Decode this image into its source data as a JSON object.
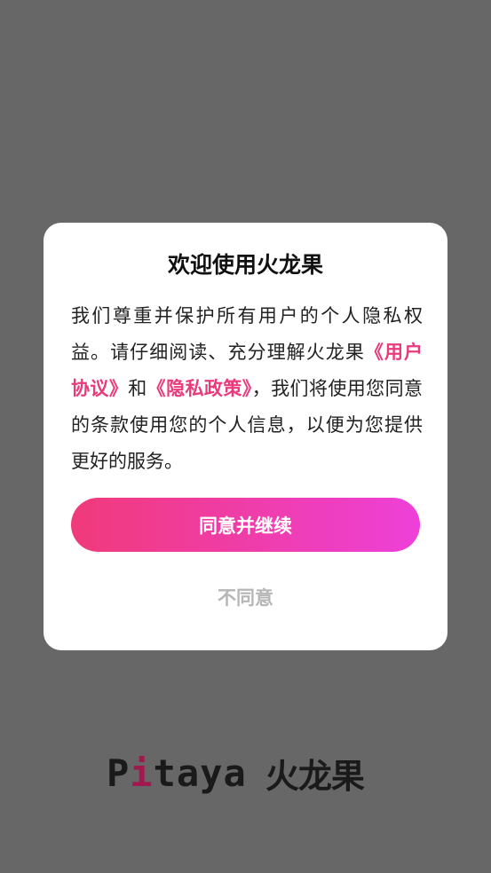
{
  "dialog": {
    "title": "欢迎使用火龙果",
    "body_part1": "我们尊重并保护所有用户的个人隐私权益。请仔细阅读、充分理解火龙果",
    "user_agreement_link": "《用户协议》",
    "conjunction": "和",
    "privacy_policy_link": "《隐私政策》",
    "body_part2": "，我们将使用您同意的条款使用您的个人信息，以便为您提供更好的服务。",
    "agree_label": "同意并继续",
    "decline_label": "不同意"
  },
  "logo": {
    "latin_first": "P",
    "latin_accent": "i",
    "latin_rest": "taya",
    "cjk": "火龙果"
  },
  "colors": {
    "overlay": "#676767",
    "link": "#ea3a7c",
    "button_gradient_start": "#f03a7a",
    "button_gradient_end": "#ee40d8",
    "decline_text": "#b6b6b6",
    "logo_accent": "#a2194f"
  }
}
